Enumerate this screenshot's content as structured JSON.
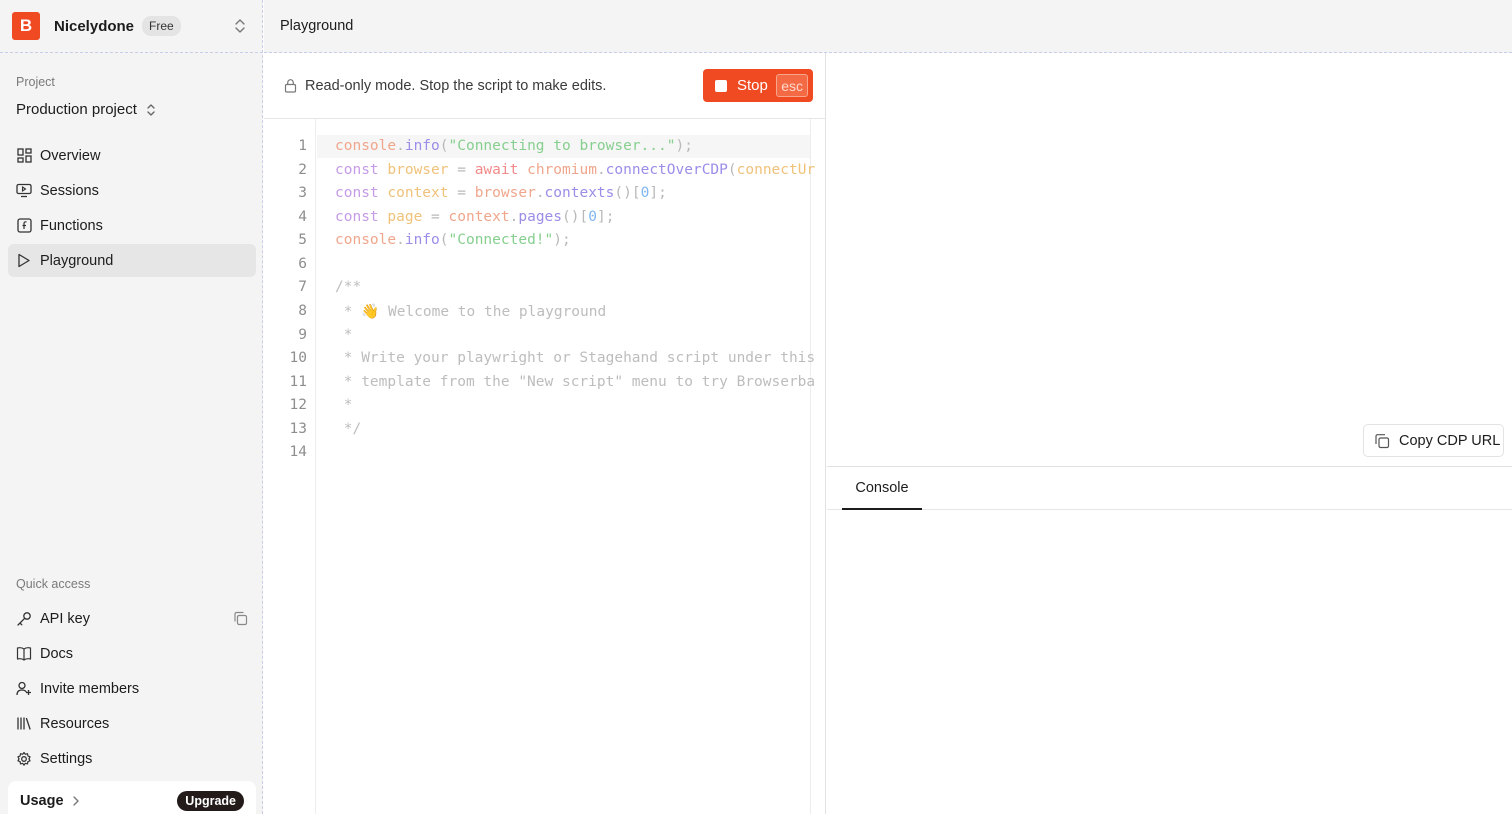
{
  "org": {
    "logo_letter": "B",
    "name": "Nicelydone",
    "plan": "Free"
  },
  "project": {
    "section_label": "Project",
    "current": "Production project"
  },
  "nav": {
    "items": [
      {
        "label": "Overview",
        "icon": "grid-icon",
        "active": false
      },
      {
        "label": "Sessions",
        "icon": "monitor-icon",
        "active": false
      },
      {
        "label": "Functions",
        "icon": "function-icon",
        "active": false
      },
      {
        "label": "Playground",
        "icon": "play-icon",
        "active": true
      }
    ]
  },
  "quick_access": {
    "section_label": "Quick access",
    "items": [
      {
        "label": "API key",
        "icon": "key-icon"
      },
      {
        "label": "Docs",
        "icon": "book-icon"
      },
      {
        "label": "Invite members",
        "icon": "user-plus-icon"
      },
      {
        "label": "Resources",
        "icon": "library-icon"
      },
      {
        "label": "Settings",
        "icon": "gear-icon"
      }
    ]
  },
  "usage": {
    "label": "Usage",
    "upgrade_label": "Upgrade"
  },
  "topbar": {
    "title": "Playground"
  },
  "editor": {
    "readonly_message": "Read-only mode. Stop the script to make edits.",
    "stop_label": "Stop",
    "stop_shortcut": "esc",
    "line_numbers": [
      "1",
      "2",
      "3",
      "4",
      "5",
      "6",
      "7",
      "8",
      "9",
      "10",
      "11",
      "12",
      "13",
      "14"
    ],
    "code_lines": [
      "console.info(\"Connecting to browser...\");",
      "const browser = await chromium.connectOverCDP(connectUr",
      "const context = browser.contexts()[0];",
      "const page = context.pages()[0];",
      "console.info(\"Connected!\");",
      "",
      "/**",
      " * 👋 Welcome to the playground",
      " *",
      " * Write your playwright or Stagehand script under this",
      " * template from the \"New script\" menu to try Browserba",
      " *",
      " */",
      ""
    ]
  },
  "preview": {
    "copy_cdp_label": "Copy CDP URL"
  },
  "console": {
    "tab_label": "Console"
  },
  "colors": {
    "brand": "#f04a22",
    "sidebar_bg": "#f4f4f4",
    "active_nav_bg": "#e6e6e6",
    "upgrade_bg": "#231a1a"
  }
}
